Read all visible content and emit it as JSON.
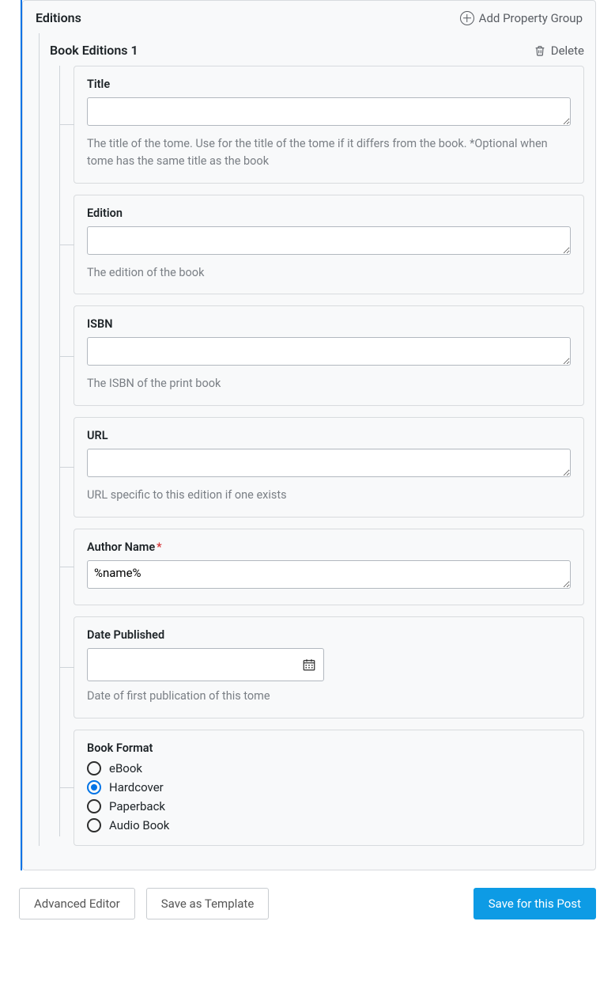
{
  "panel": {
    "title": "Editions",
    "addGroupLabel": "Add Property Group"
  },
  "group": {
    "title": "Book Editions 1",
    "deleteLabel": "Delete"
  },
  "fields": {
    "title": {
      "label": "Title",
      "value": "",
      "help": "The title of the tome. Use for the title of the tome if it differs from the book. *Optional when tome has the same title as the book"
    },
    "edition": {
      "label": "Edition",
      "value": "",
      "help": "The edition of the book"
    },
    "isbn": {
      "label": "ISBN",
      "value": "",
      "help": "The ISBN of the print book"
    },
    "url": {
      "label": "URL",
      "value": "",
      "help": "URL specific to this edition if one exists"
    },
    "authorName": {
      "label": "Author Name",
      "required": true,
      "value": "%name%"
    },
    "datePublished": {
      "label": "Date Published",
      "value": "",
      "help": "Date of first publication of this tome"
    },
    "bookFormat": {
      "label": "Book Format",
      "options": [
        {
          "label": "eBook",
          "selected": false
        },
        {
          "label": "Hardcover",
          "selected": true
        },
        {
          "label": "Paperback",
          "selected": false
        },
        {
          "label": "Audio Book",
          "selected": false
        }
      ]
    }
  },
  "footer": {
    "advancedEditor": "Advanced Editor",
    "saveTemplate": "Save as Template",
    "savePost": "Save for this Post"
  }
}
